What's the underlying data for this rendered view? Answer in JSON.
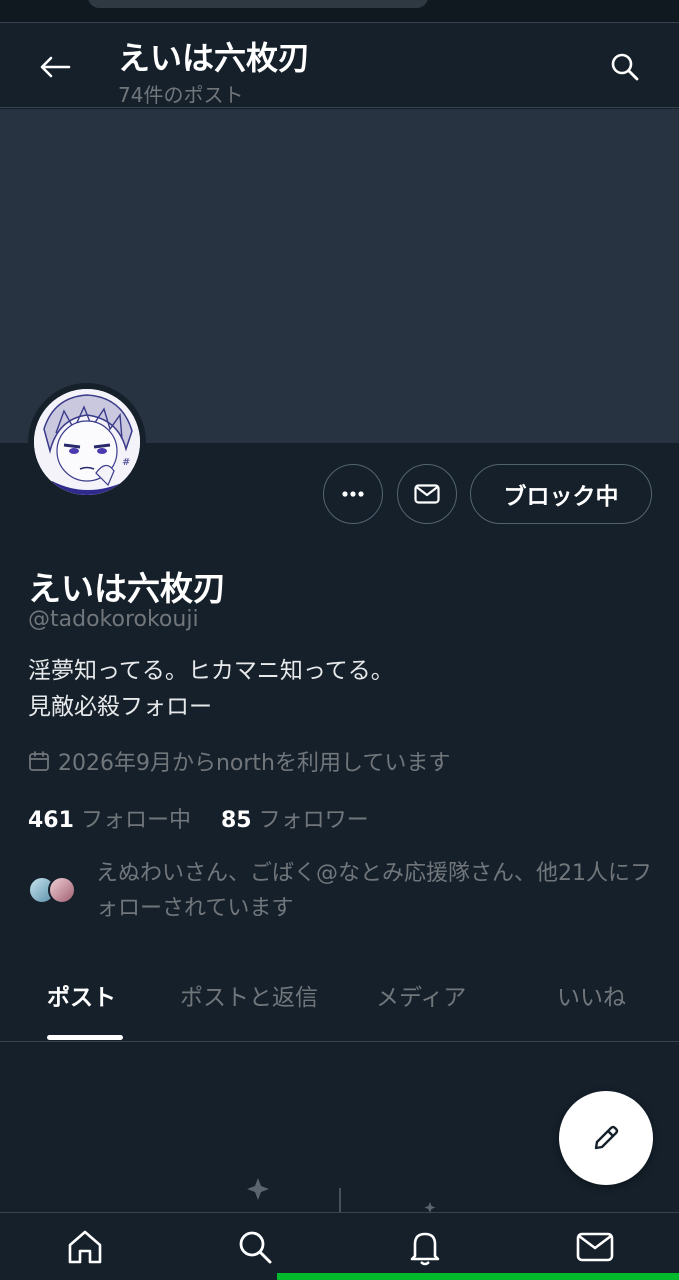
{
  "header": {
    "title": "えいは六枚刃",
    "post_count": "74件のポスト"
  },
  "profile": {
    "display_name": "えいは六枚刃",
    "handle": "@tadokorokouji",
    "bio_line1": "淫夢知ってる。ヒカマニ知ってる。",
    "bio_line2": "見敵必殺フォロー",
    "joined": "2026年9月からnorthを利用しています",
    "following_count": "461",
    "following_label": "フォロー中",
    "followers_count": "85",
    "followers_label": "フォロワー",
    "followed_by": "えぬわいさん、ごばく@なとみ応援隊さん、他21人にフォローされています"
  },
  "actions": {
    "block_label": "ブロック中"
  },
  "tabs": [
    {
      "label": "ポスト",
      "active": true
    },
    {
      "label": "ポストと返信",
      "active": false
    },
    {
      "label": "メディア",
      "active": false
    },
    {
      "label": "いいね",
      "active": false
    }
  ],
  "colors": {
    "background": "#15202b",
    "banner": "#273340",
    "muted_text": "#71767b",
    "border": "#38444d",
    "system_bar_accent": "#00ba2c"
  },
  "icons": {
    "back": "back-arrow-icon",
    "search": "search-icon",
    "more": "more-dots-icon",
    "message": "envelope-icon",
    "calendar": "calendar-icon",
    "compose": "pencil-icon",
    "nav": [
      "home-icon",
      "search-icon",
      "bell-icon",
      "envelope-icon"
    ]
  }
}
